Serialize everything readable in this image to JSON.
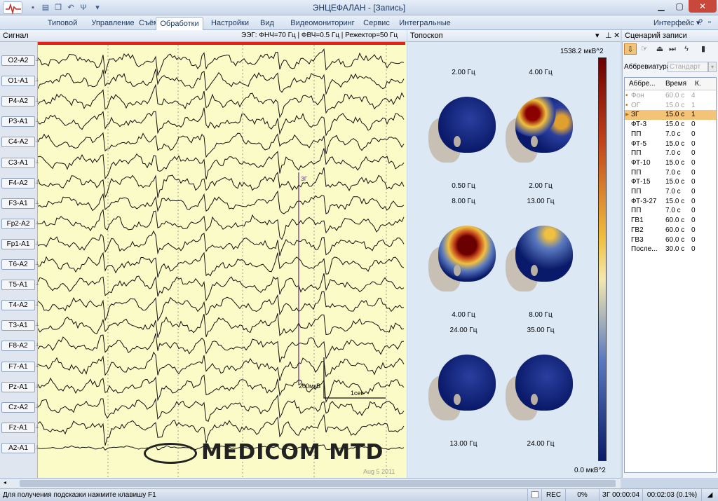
{
  "window": {
    "title": "ЭНЦЕФАЛАН - [Запись]",
    "min_icon": "minimize-icon",
    "max_icon": "maximize-icon",
    "close_icon": "close-icon"
  },
  "menu": {
    "tabs": [
      "Типовой",
      "Управление",
      "Съём",
      "Обработки",
      "Настройки",
      "Вид",
      "Видеомониторинг",
      "Сервис",
      "Интегральные"
    ],
    "active": "Обработки",
    "right_label": "Интерфейс"
  },
  "signal_panel": {
    "title": "Сигнал",
    "filters": "ЭЭГ: ФНЧ=70 Гц | ФВЧ=0.5 Гц | Режектор=50 Гц",
    "channels": [
      "O2-A2",
      "O1-A1",
      "P4-A2",
      "P3-A1",
      "C4-A2",
      "C3-A1",
      "F4-A2",
      "F3-A1",
      "Fp2-A2",
      "Fp1-A1",
      "T6-A2",
      "T5-A1",
      "T4-A2",
      "T3-A1",
      "F8-A2",
      "F7-A1",
      "Pz-A1",
      "Cz-A2",
      "Fz-A1",
      "A2-A1"
    ],
    "marker_label": "ЗГ",
    "scale_amp": "200мкВ",
    "scale_time": "1сек",
    "watermark": "MEDICOM MTD",
    "date": "Aug  5 2011"
  },
  "topo_panel": {
    "title": "Топоскоп",
    "colorbar_max": "1538.2 мкВ^2",
    "colorbar_min": "0.0 мкВ^2",
    "maps": [
      {
        "top": "2.00 Гц",
        "bottom": "0.50 Гц",
        "hot": "none"
      },
      {
        "top": "4.00 Гц",
        "bottom": "2.00 Гц",
        "hot": "left-right"
      },
      {
        "top": "8.00 Гц",
        "bottom": "4.00 Гц",
        "hot": "center"
      },
      {
        "top": "13.00 Гц",
        "bottom": "8.00 Гц",
        "hot": "top"
      },
      {
        "top": "24.00 Гц",
        "bottom": "13.00 Гц",
        "hot": "none"
      },
      {
        "top": "35.00 Гц",
        "bottom": "24.00 Гц",
        "hot": "none"
      }
    ]
  },
  "scenario": {
    "title": "Сценарий записи",
    "abbr_label": "Аббревиатура",
    "abbr_value": "Стандарт",
    "columns": [
      "Аббре...",
      "Время",
      "К."
    ],
    "rows": [
      {
        "a": "Фон",
        "t": "60.0 с",
        "k": "4",
        "state": "done"
      },
      {
        "a": "ОГ",
        "t": "15.0 с",
        "k": "1",
        "state": "done"
      },
      {
        "a": "ЗГ",
        "t": "15.0 с",
        "k": "1",
        "state": "current"
      },
      {
        "a": "ФТ-3",
        "t": "15.0 с",
        "k": "0",
        "state": ""
      },
      {
        "a": "ПП",
        "t": "7.0 с",
        "k": "0",
        "state": ""
      },
      {
        "a": "ФТ-5",
        "t": "15.0 с",
        "k": "0",
        "state": ""
      },
      {
        "a": "ПП",
        "t": "7.0 с",
        "k": "0",
        "state": ""
      },
      {
        "a": "ФТ-10",
        "t": "15.0 с",
        "k": "0",
        "state": ""
      },
      {
        "a": "ПП",
        "t": "7.0 с",
        "k": "0",
        "state": ""
      },
      {
        "a": "ФТ-15",
        "t": "15.0 с",
        "k": "0",
        "state": ""
      },
      {
        "a": "ПП",
        "t": "7.0 с",
        "k": "0",
        "state": ""
      },
      {
        "a": "ФТ-3-27",
        "t": "15.0 с",
        "k": "0",
        "state": ""
      },
      {
        "a": "ПП",
        "t": "7.0 с",
        "k": "0",
        "state": ""
      },
      {
        "a": "ГВ1",
        "t": "60.0 с",
        "k": "0",
        "state": ""
      },
      {
        "a": "ГВ2",
        "t": "60.0 с",
        "k": "0",
        "state": ""
      },
      {
        "a": "ГВ3",
        "t": "60.0 с",
        "k": "0",
        "state": ""
      },
      {
        "a": "После...",
        "t": "30.0 с",
        "k": "0",
        "state": ""
      }
    ]
  },
  "status": {
    "hint": "Для получения подсказки нажмите клавишу F1",
    "rec": "REC",
    "percent": "0%",
    "seg_time": "ЗГ 00:00:04",
    "total": "00:02:03 (0.1%)"
  },
  "colors": {
    "signal_bg": "#fbfbc8",
    "topo_bg": "#dde8f5",
    "hot": "#8b0000",
    "cold": "#0a1a6a",
    "selected_row": "#f3c478"
  }
}
